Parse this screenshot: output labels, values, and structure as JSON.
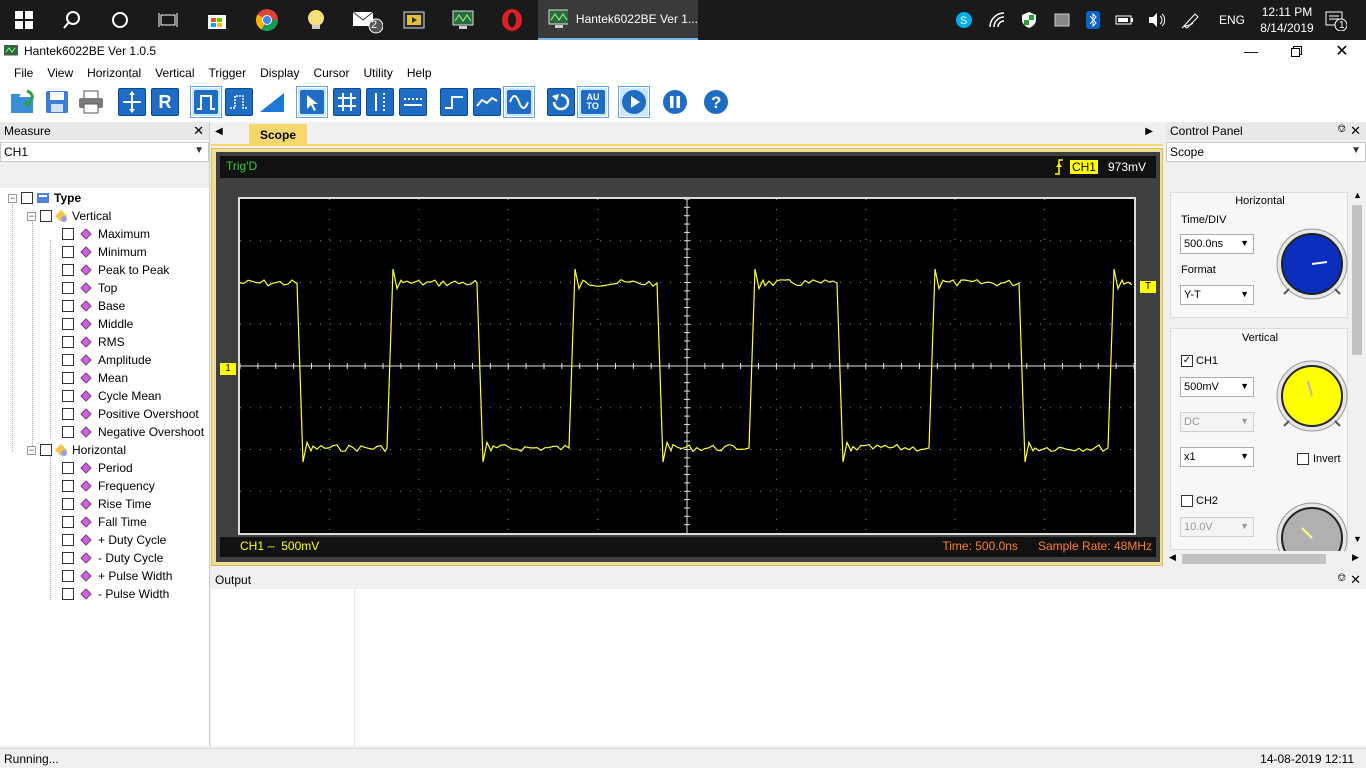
{
  "taskbar": {
    "active_window_label": "Hantek6022BE Ver 1...",
    "mail_badge": "2",
    "language": "ENG",
    "time": "12:11 PM",
    "date": "8/14/2019",
    "notification_count": "1"
  },
  "window": {
    "title": "Hantek6022BE Ver 1.0.5"
  },
  "menu": [
    "File",
    "View",
    "Horizontal",
    "Vertical",
    "Trigger",
    "Display",
    "Cursor",
    "Utility",
    "Help"
  ],
  "measure": {
    "title": "Measure",
    "channel": "CH1",
    "tree_root": "Type",
    "vertical_label": "Vertical",
    "vertical_items": [
      "Maximum",
      "Minimum",
      "Peak to Peak",
      "Top",
      "Base",
      "Middle",
      "RMS",
      "Amplitude",
      "Mean",
      "Cycle Mean",
      "Positive Overshoot",
      "Negative Overshoot"
    ],
    "horizontal_label": "Horizontal",
    "horizontal_items": [
      "Period",
      "Frequency",
      "Rise Time",
      "Fall Time",
      "+ Duty Cycle",
      "- Duty Cycle",
      "+ Pulse Width",
      "- Pulse Width"
    ]
  },
  "scope": {
    "tab": "Scope",
    "trig_status": "Trig'D",
    "trig_channel": "CH1",
    "trig_level": "973mV",
    "ch1_scale_label": "CH1",
    "ch1_scale_value": "500mV",
    "time_label": "Time: 500.0ns",
    "sample_rate": "Sample Rate: 48MHz",
    "ch1_marker": "1",
    "trigger_marker": "T",
    "trace_color": "#ffff33",
    "grid_color": "#c8c8c8"
  },
  "control": {
    "title": "Control Panel",
    "mode": "Scope",
    "horizontal_title": "Horizontal",
    "time_div_label": "Time/DIV",
    "time_div": "500.0ns",
    "format_label": "Format",
    "format": "Y-T",
    "vertical_title": "Vertical",
    "ch1_label": "CH1",
    "ch1_volts": "500mV",
    "ch1_coupling": "DC",
    "ch1_probe": "x1",
    "invert_label": "Invert",
    "ch2_label": "CH2",
    "ch2_volts": "10.0V",
    "knob_h_color": "#0a2dbd",
    "knob_ch1_color": "#ffff00",
    "knob_ch2_color": "#b0b0b0"
  },
  "output": {
    "title": "Output"
  },
  "status": {
    "left": "Running...",
    "right": "14-08-2019  12:11"
  }
}
